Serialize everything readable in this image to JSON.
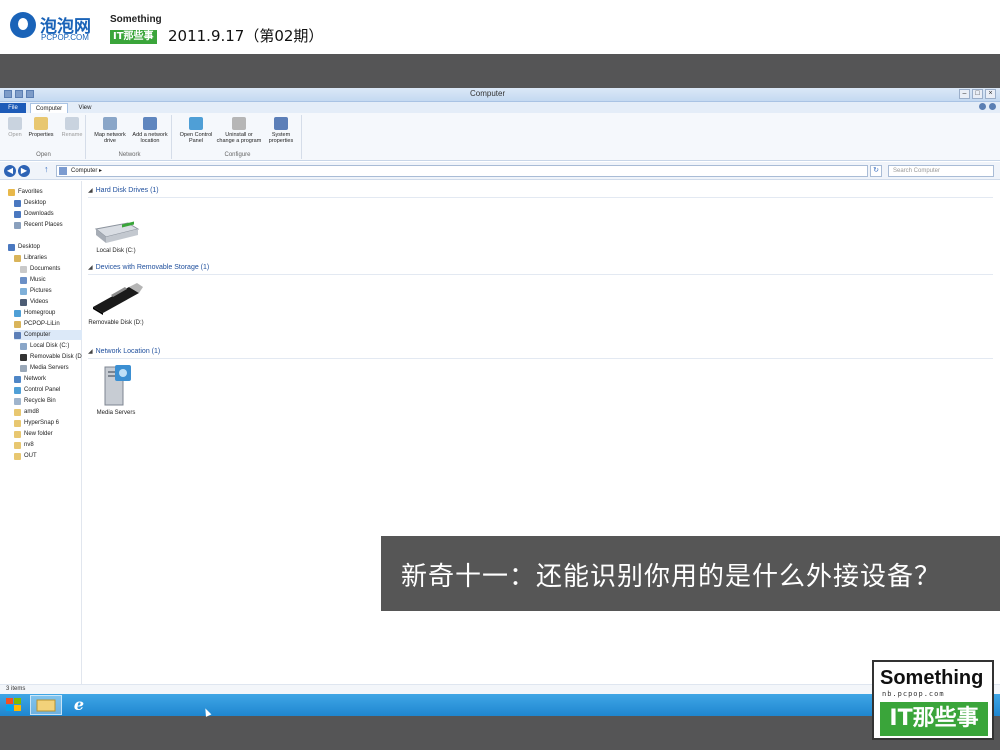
{
  "header": {
    "logo_cn": "泡泡网",
    "logo_en": "PCPOP.COM",
    "brand_top": "Something",
    "brand_bottom": "IT那些事",
    "issue": "2011.9.17（第02期）"
  },
  "window": {
    "title": "Computer",
    "tabs": {
      "file": "File",
      "computer": "Computer",
      "view": "View"
    }
  },
  "ribbon": {
    "open": "Open",
    "properties": "Properties",
    "rename": "Rename",
    "group_open": "Open",
    "map_network_drive": "Map network drive",
    "add_network_location": "Add a network location",
    "group_network": "Network",
    "open_control_panel": "Open Control Panel",
    "uninstall_program": "Uninstall or change a program",
    "system_properties": "System properties",
    "group_configure": "Configure"
  },
  "address": {
    "path": "Computer ▸",
    "search_placeholder": "Search Computer"
  },
  "nav": {
    "favorites": "Favorites",
    "desktop_fav": "Desktop",
    "downloads": "Downloads",
    "recent_places": "Recent Places",
    "desktop": "Desktop",
    "libraries": "Libraries",
    "documents": "Documents",
    "music": "Music",
    "pictures": "Pictures",
    "videos": "Videos",
    "homegroup": "Homegroup",
    "pcpop_user": "PCPOP-LiLin",
    "computer": "Computer",
    "local_disk": "Local Disk (C:)",
    "removable_disk": "Removable Disk (D",
    "media_servers": "Media Servers",
    "network": "Network",
    "control_panel": "Control Panel",
    "recycle_bin": "Recycle Bin",
    "amd8": "amd8",
    "hypersnap": "HyperSnap 6",
    "new_folder": "New folder",
    "nv8": "nv8",
    "out": "OUT"
  },
  "content": {
    "hdd_header": "Hard Disk Drives (1)",
    "local_disk": "Local Disk (C:)",
    "removable_header": "Devices with Removable Storage (1)",
    "removable_disk": "Removable Disk (D:)",
    "network_header": "Network Location (1)",
    "media_servers": "Media Servers"
  },
  "status": {
    "items": "3 items"
  },
  "caption": "新奇十一：还能识别你用的是什么外接设备？",
  "badge": {
    "top": "Something",
    "url": "nb.pcpop.com",
    "bottom": "IT那些事"
  },
  "colors": {
    "frame": "#555556",
    "brand_green": "#3aa53a",
    "brand_blue": "#1a63b8",
    "taskbar": "#1f86cf"
  }
}
